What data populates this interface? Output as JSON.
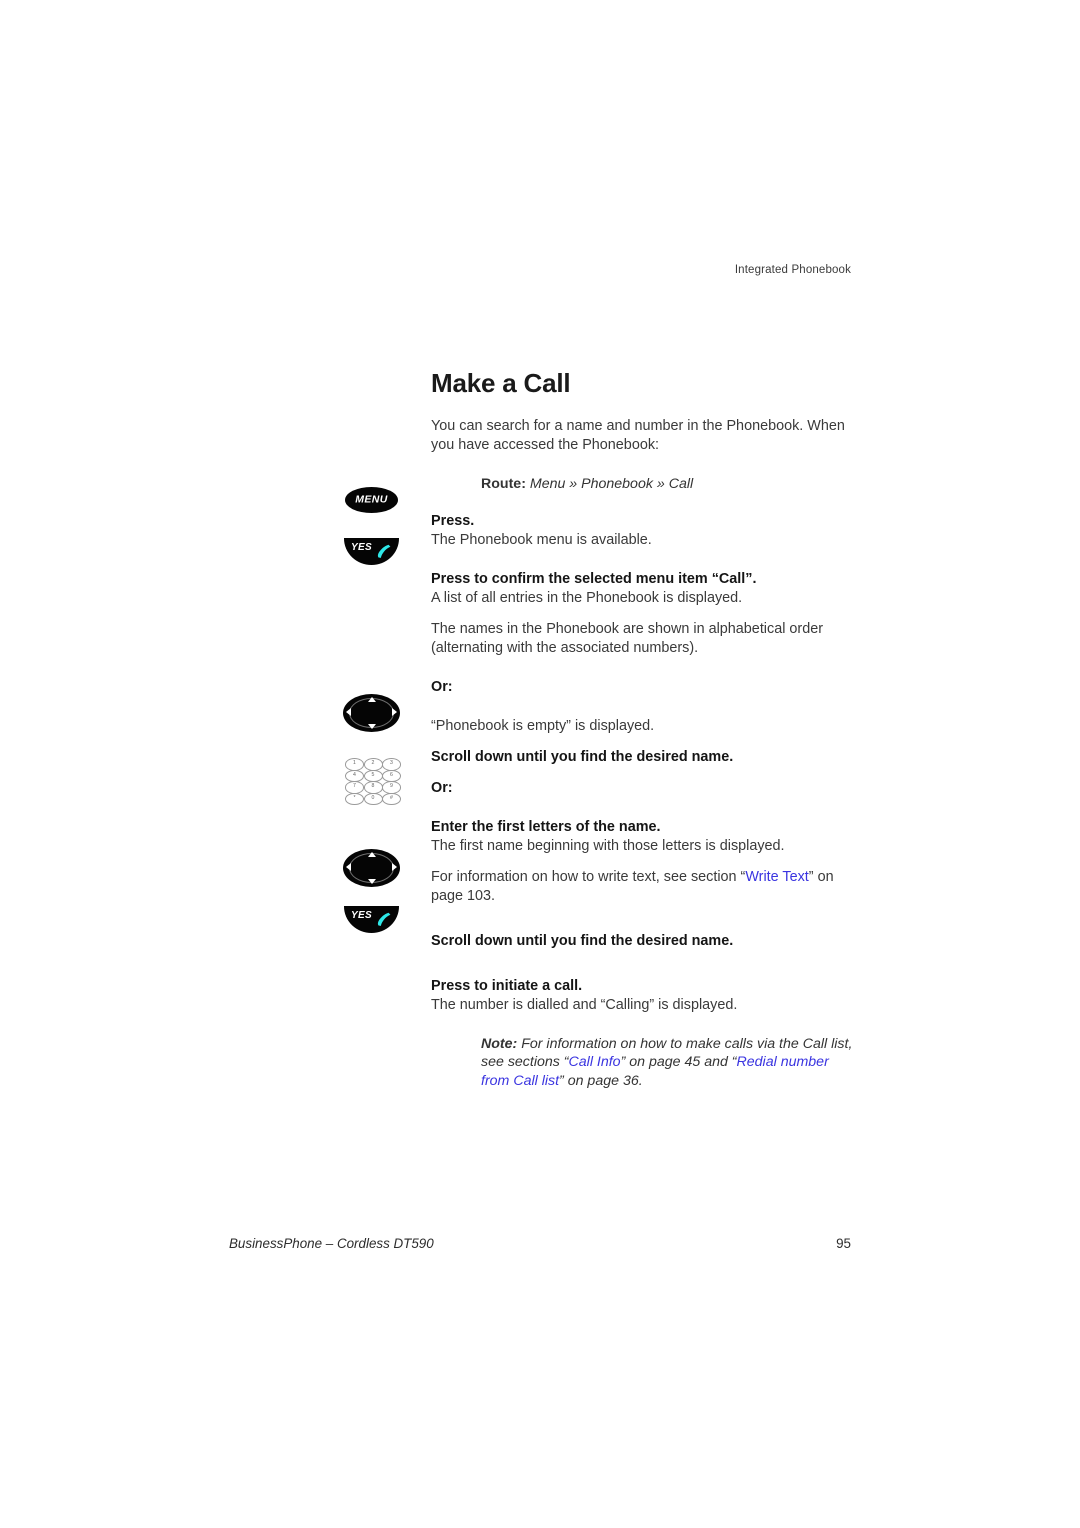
{
  "header": {
    "running_head": "Integrated Phonebook"
  },
  "main": {
    "title": "Make a Call",
    "intro": "You can search for a name and number in the Phonebook. When you have accessed the Phonebook:",
    "route": {
      "label": "Route:",
      "path": "Menu » Phonebook » Call"
    },
    "steps": [
      {
        "icon": "menu-key",
        "icon_label": "MENU",
        "lead": "Press.",
        "sub": "The Phonebook menu is available."
      },
      {
        "icon": "yes-key",
        "icon_label": "YES",
        "lead": "Press to confirm the selected menu item “Call”.",
        "sub": "A list of all entries in the Phonebook is displayed."
      }
    ],
    "paragraph_alphabetical": "The names in the Phonebook are shown in alphabetical order (alternating with the associated numbers).",
    "or_label_1": "Or:",
    "empty_message": "“Phonebook is empty” is displayed.",
    "scroll_step_1": {
      "icon": "navigation-key",
      "lead": "Scroll down until you find the desired name."
    },
    "or_label_2": "Or:",
    "keypad_step": {
      "icon": "dial-keypad",
      "lead": "Enter the first letters of the name.",
      "sub": "The first name beginning with those letters is displayed."
    },
    "write_text_note": {
      "before": "For information on how to write text, see section “",
      "link": "Write Text",
      "after": "” on page 103."
    },
    "scroll_step_2": {
      "icon": "navigation-key",
      "lead": "Scroll down until you find the desired name."
    },
    "call_step": {
      "icon": "yes-key",
      "icon_label": "YES",
      "lead": "Press to initiate a call.",
      "sub": "The number is dialled and “Calling” is displayed."
    },
    "note": {
      "label": "Note:",
      "text_1": " For information on how to make calls via the Call list, see sections “",
      "link_1": "Call Info",
      "text_2": "” on page 45 and “",
      "link_2": "Redial number from Call list",
      "text_3": "” on page 36."
    }
  },
  "keypad": {
    "keys": [
      "1",
      "2",
      "3",
      "4",
      "5",
      "6",
      "7",
      "8",
      "9",
      "*",
      "0",
      "#"
    ]
  },
  "footer": {
    "document": "BusinessPhone – Cordless DT590",
    "page": "95"
  },
  "colors": {
    "link": "#3a34e0",
    "key_black": "#050505",
    "handset_cyan": "#2ee8e8",
    "text": "#3a3a3a"
  }
}
